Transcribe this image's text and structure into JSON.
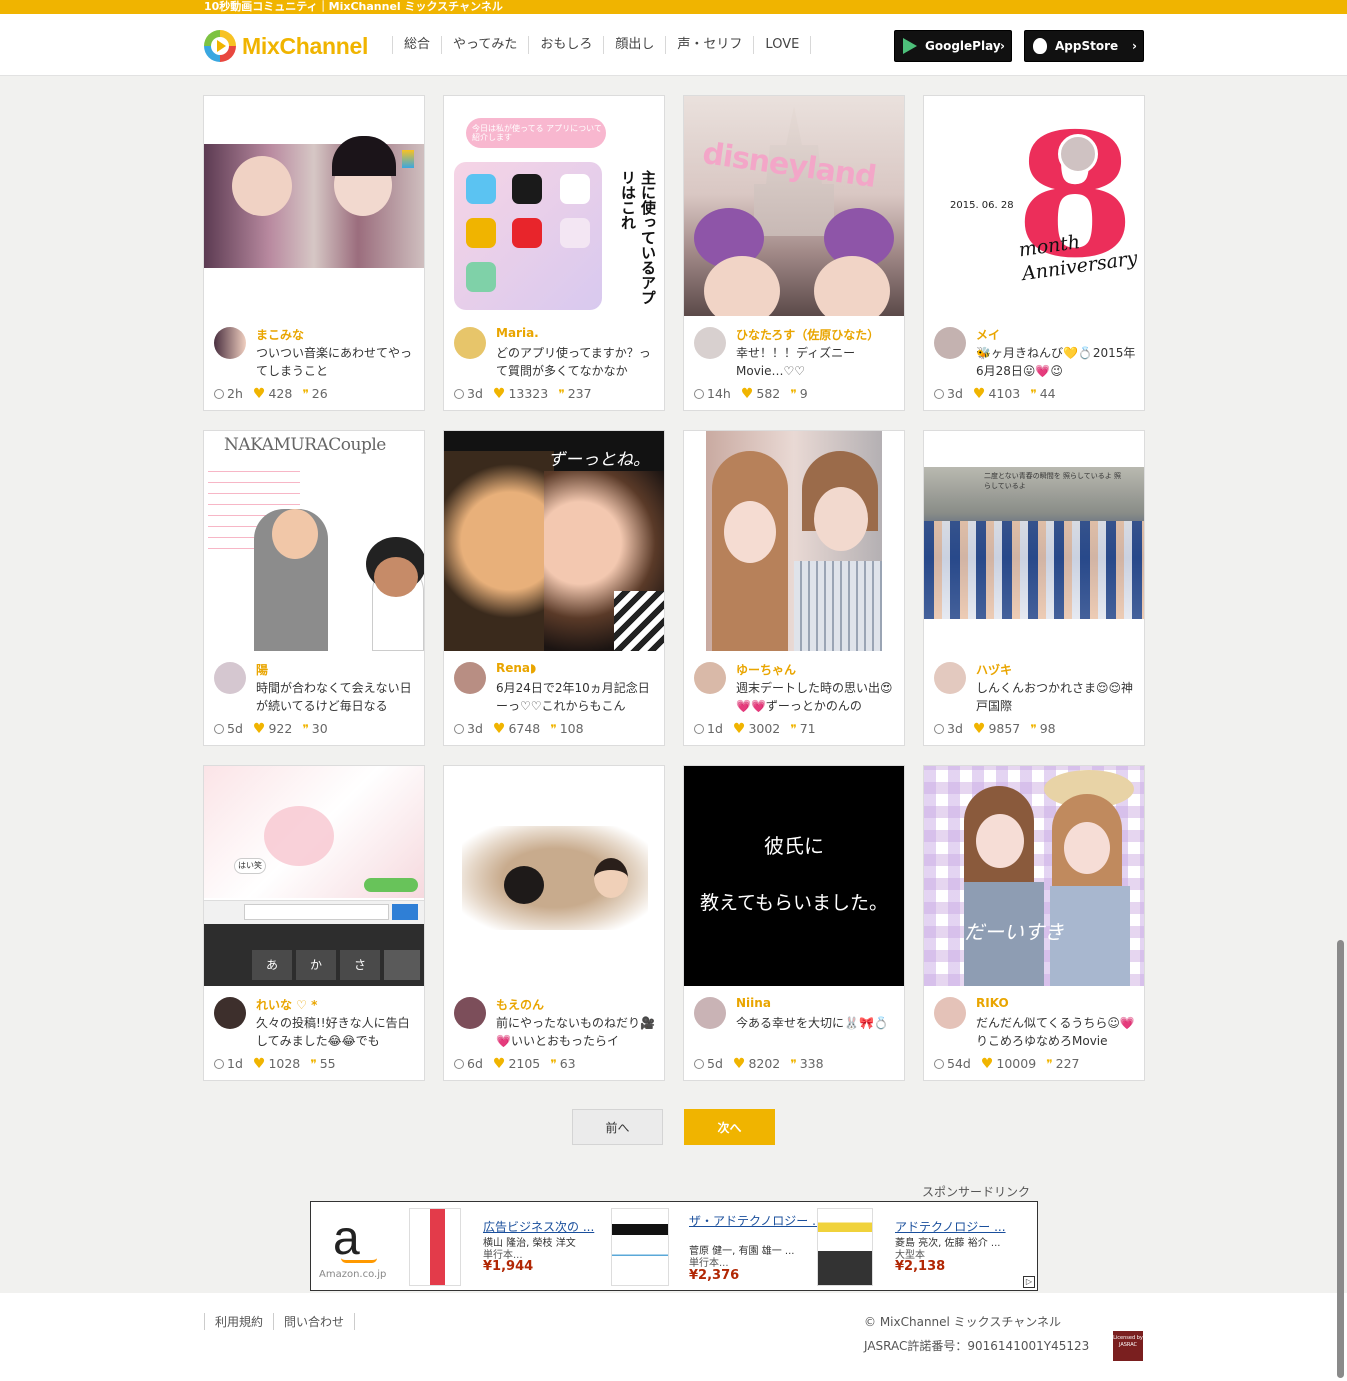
{
  "site": {
    "tagline": "10秒動画コミュニティ｜MixChannel ミックスチャンネル",
    "logo_text": "MixChannel"
  },
  "nav": [
    "総合",
    "やってみた",
    "おもしろ",
    "顔出し",
    "声・セリフ",
    "LOVE"
  ],
  "stores": {
    "google": "GooglePlay",
    "apple": "AppStore",
    "chevron": "›"
  },
  "cards": [
    {
      "user": "まこみな",
      "desc": "ついつい音楽にあわせてやってしまうこと",
      "time": "2h",
      "likes": "428",
      "comments": "26"
    },
    {
      "user": "Maria.",
      "desc": "どのアプリ使ってますか？って質問が多くてなかなか",
      "time": "3d",
      "likes": "13323",
      "comments": "237"
    },
    {
      "user": "ひなたろす（佐原ひなた）",
      "desc": "幸せ！！！ディズニーMovie…♡♡",
      "time": "14h",
      "likes": "582",
      "comments": "9"
    },
    {
      "user": "メイ",
      "desc": "🐝ヶ月きねんび💛💍2015年6月28日😛💗😉",
      "time": "3d",
      "likes": "4103",
      "comments": "44"
    },
    {
      "user": "陽",
      "desc": "時間が合わなくて会えない日が続いてるけど毎日なる",
      "time": "5d",
      "likes": "922",
      "comments": "30"
    },
    {
      "user": "Rena◗",
      "desc": "6月24日で2年10ヵ月記念日ーっ♡♡これからもこん",
      "time": "3d",
      "likes": "6748",
      "comments": "108"
    },
    {
      "user": "ゆーちゃん",
      "desc": "週末デートした時の思い出😍💗💗ずーっとかのんの",
      "time": "1d",
      "likes": "3002",
      "comments": "71"
    },
    {
      "user": "ハヅキ",
      "desc": "しんくんおつかれさま😌😌神戸国際",
      "time": "3d",
      "likes": "9857",
      "comments": "98"
    },
    {
      "user": "れいな ♡ *",
      "desc": "久々の投稿!!好きな人に告白してみました😂😂でも",
      "time": "1d",
      "likes": "1028",
      "comments": "55"
    },
    {
      "user": "もえのん",
      "desc": "前にやったないものねだり🎥💗いいとおもったらイ",
      "time": "6d",
      "likes": "2105",
      "comments": "63"
    },
    {
      "user": "Niina",
      "desc": "今ある幸せを大切に🐰🎀💍",
      "time": "5d",
      "likes": "8202",
      "comments": "338"
    },
    {
      "user": "RIKO",
      "desc": "だんだん似てくるうちら☺︎💗りこめろゆなめろMovie",
      "time": "54d",
      "likes": "10009",
      "comments": "227"
    }
  ],
  "thumb_text": {
    "card2_title": "今日は私が使ってる アプリについて紹介します",
    "card2_side": "主に使っているアプリはこれ",
    "card3_overlay": "disneyland",
    "card4_date": "2015. 06. 28",
    "card4_num": "8",
    "card4_text": "month Anniversary",
    "card5_title": "NAKAMURACouple",
    "card6_overlay": "ずーっとね。",
    "card8_caption": "二度とない青春の瞬間を 照らしているよ 照らしているよ",
    "card9_bubble": "はい笑",
    "card9_keys": [
      "あ",
      "か",
      "さ"
    ],
    "card11_line1": "彼氏に",
    "card11_line2": "教えてもらいました。",
    "card12_overlay": "だーいすき"
  },
  "pagination": {
    "prev": "前へ",
    "next": "次へ"
  },
  "ads": {
    "sponsor_label": "スポンサードリンク",
    "amazon_letter": "a",
    "amazon_domain": "Amazon.co.jp",
    "products": [
      {
        "title": "広告ビジネス次の ...",
        "author": "横山 隆治, 榮枝 洋文",
        "type": "単行本...",
        "price": "¥1,944"
      },
      {
        "title": "ザ・アドテクノロジー ...",
        "author": "菅原 健一, 有園 雄一 ...",
        "type": "単行本...",
        "price": "¥2,376"
      },
      {
        "title": "アドテクノロジー ...",
        "author": "菱島 亮次, 佐藤 裕介 ...",
        "type": "大型本",
        "price": "¥2,138"
      }
    ],
    "adchoice": "▷"
  },
  "footer": {
    "links": [
      "利用規約",
      "問い合わせ"
    ],
    "copyright": "© MixChannel ミックスチャンネル",
    "jasrac": "JASRAC許諾番号：9016141001Y45123",
    "jasrac_logo": "Licensed by JASRAC"
  },
  "colors": {
    "accent": "#f0b400",
    "username": "#e9a500",
    "price": "#b12704"
  }
}
